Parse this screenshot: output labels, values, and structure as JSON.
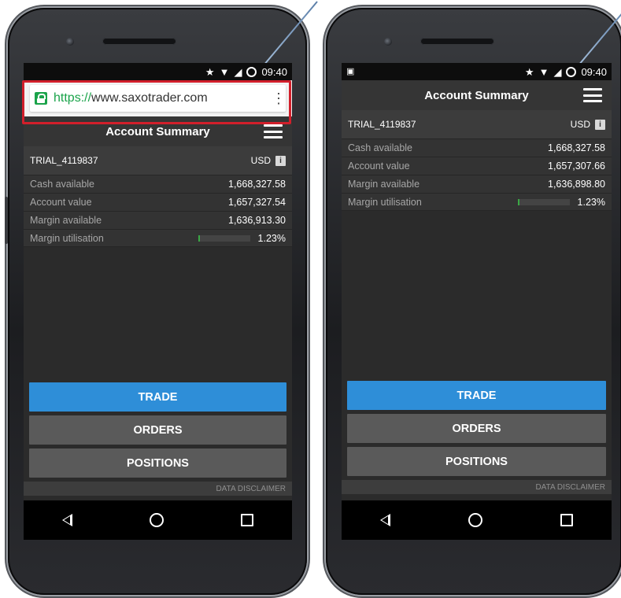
{
  "left_phone": {
    "status_bar": {
      "time": "09:40"
    },
    "url_bar": {
      "scheme": "https://",
      "host": "www.saxotrader.com"
    },
    "header": {
      "title": "Account Summary"
    },
    "account": {
      "id": "TRIAL_4119837",
      "currency": "USD",
      "info": "i"
    },
    "metrics": [
      {
        "label": "Cash available",
        "value": "1,668,327.58"
      },
      {
        "label": "Account value",
        "value": "1,657,327.54"
      },
      {
        "label": "Margin available",
        "value": "1,636,913.30"
      }
    ],
    "utilisation": {
      "label": "Margin utilisation",
      "value": "1.23%",
      "percent": 1.23
    },
    "buttons": {
      "trade": "TRADE",
      "orders": "ORDERS",
      "positions": "POSITIONS"
    },
    "disclaimer": "DATA DISCLAIMER"
  },
  "right_phone": {
    "status_bar": {
      "time": "09:40"
    },
    "header": {
      "title": "Account Summary"
    },
    "account": {
      "id": "TRIAL_4119837",
      "currency": "USD",
      "info": "i"
    },
    "metrics": [
      {
        "label": "Cash available",
        "value": "1,668,327.58"
      },
      {
        "label": "Account value",
        "value": "1,657,307.66"
      },
      {
        "label": "Margin available",
        "value": "1,636,898.80"
      }
    ],
    "utilisation": {
      "label": "Margin utilisation",
      "value": "1.23%",
      "percent": 1.23
    },
    "buttons": {
      "trade": "TRADE",
      "orders": "ORDERS",
      "positions": "POSITIONS"
    },
    "disclaimer": "DATA DISCLAIMER"
  },
  "icons": {
    "status": [
      "star-icon",
      "wifi-icon",
      "signal-icon",
      "sync-icon"
    ],
    "nav": [
      "back-icon",
      "home-icon",
      "recent-apps-icon"
    ]
  },
  "colors": {
    "trade_button": "#2e8ed8",
    "secure_lock": "#1aa34a",
    "highlight_box": "#d21f2b",
    "utilisation_bar": "#3aa845"
  }
}
